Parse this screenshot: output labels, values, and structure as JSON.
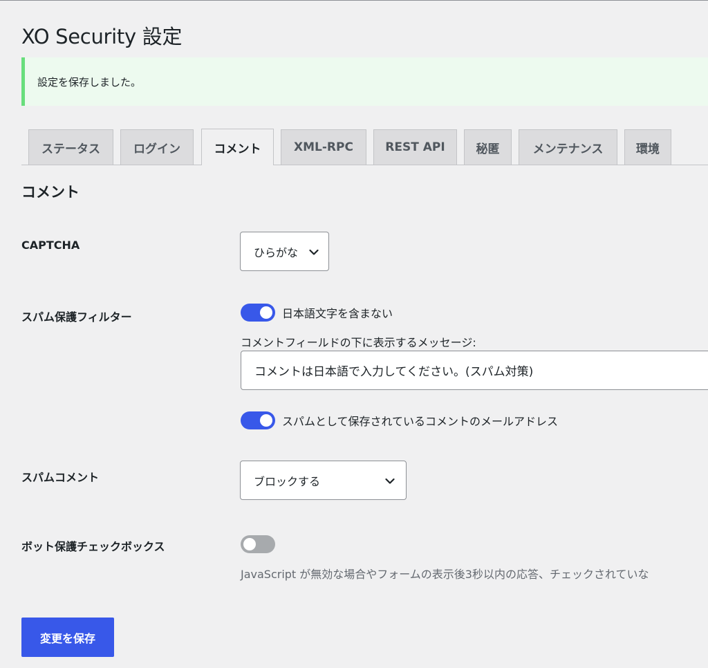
{
  "page": {
    "title": "XO Security 設定"
  },
  "notice": {
    "message": "設定を保存しました。"
  },
  "tabs": [
    {
      "label": "ステータス",
      "active": false
    },
    {
      "label": "ログイン",
      "active": false
    },
    {
      "label": "コメント",
      "active": true
    },
    {
      "label": "XML-RPC",
      "active": false
    },
    {
      "label": "REST API",
      "active": false
    },
    {
      "label": "秘匿",
      "active": false
    },
    {
      "label": "メンテナンス",
      "active": false
    },
    {
      "label": "環境",
      "active": false
    }
  ],
  "section": {
    "title": "コメント"
  },
  "captcha": {
    "label": "CAPTCHA",
    "selected": "ひらがな"
  },
  "spam_filter": {
    "label": "スパム保護フィルター",
    "toggle_japanese": {
      "label": "日本語文字を含まない",
      "on": true
    },
    "message_label": "コメントフィールドの下に表示するメッセージ:",
    "message_value": "コメントは日本語で入力してください。(スパム対策)",
    "toggle_email": {
      "label": "スパムとして保存されているコメントのメールアドレス",
      "on": true
    }
  },
  "spam_comment": {
    "label": "スパムコメント",
    "selected": "ブロックする"
  },
  "bot_checkbox": {
    "label": "ボット保護チェックボックス",
    "on": false,
    "description": "JavaScript が無効な場合やフォームの表示後3秒以内の応答、チェックされていな"
  },
  "submit": {
    "label": "変更を保存"
  },
  "colors": {
    "accent": "#3858e9",
    "notice_border": "#68de7c",
    "background": "#f0f0f1"
  }
}
